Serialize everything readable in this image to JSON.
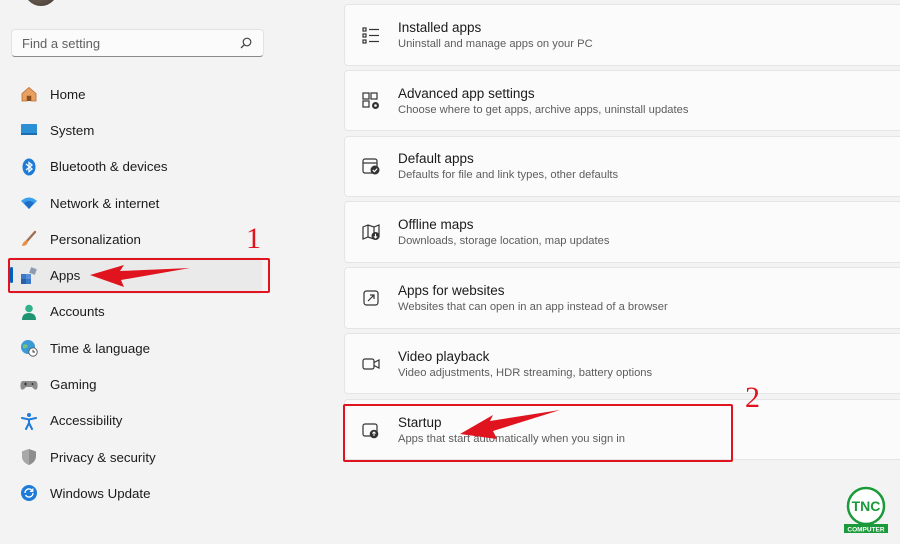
{
  "search": {
    "placeholder": "Find a setting"
  },
  "sidebar": {
    "items": [
      {
        "label": "Home",
        "icon": "home-icon"
      },
      {
        "label": "System",
        "icon": "monitor-icon"
      },
      {
        "label": "Bluetooth & devices",
        "icon": "bluetooth-icon"
      },
      {
        "label": "Network & internet",
        "icon": "wifi-icon"
      },
      {
        "label": "Personalization",
        "icon": "brush-icon"
      },
      {
        "label": "Apps",
        "icon": "apps-icon",
        "active": true
      },
      {
        "label": "Accounts",
        "icon": "person-icon"
      },
      {
        "label": "Time & language",
        "icon": "globe-clock-icon"
      },
      {
        "label": "Gaming",
        "icon": "gamepad-icon"
      },
      {
        "label": "Accessibility",
        "icon": "accessibility-icon"
      },
      {
        "label": "Privacy & security",
        "icon": "shield-icon"
      },
      {
        "label": "Windows Update",
        "icon": "update-icon"
      }
    ]
  },
  "main": {
    "cards": [
      {
        "title": "Installed apps",
        "desc": "Uninstall and manage apps on your PC",
        "icon": "list-icon"
      },
      {
        "title": "Advanced app settings",
        "desc": "Choose where to get apps, archive apps, uninstall updates",
        "icon": "app-gear-icon"
      },
      {
        "title": "Default apps",
        "desc": "Defaults for file and link types, other defaults",
        "icon": "default-apps-icon"
      },
      {
        "title": "Offline maps",
        "desc": "Downloads, storage location, map updates",
        "icon": "map-icon"
      },
      {
        "title": "Apps for websites",
        "desc": "Websites that can open in an app instead of a browser",
        "icon": "open-external-icon"
      },
      {
        "title": "Video playback",
        "desc": "Video adjustments, HDR streaming, battery options",
        "icon": "video-icon"
      },
      {
        "title": "Startup",
        "desc": "Apps that start automatically when you sign in",
        "icon": "startup-icon"
      }
    ]
  },
  "annotations": {
    "step1": "1",
    "step2": "2",
    "color": "#e0141e"
  },
  "logo": {
    "text": "TNC",
    "subtext": "COMPUTER"
  }
}
